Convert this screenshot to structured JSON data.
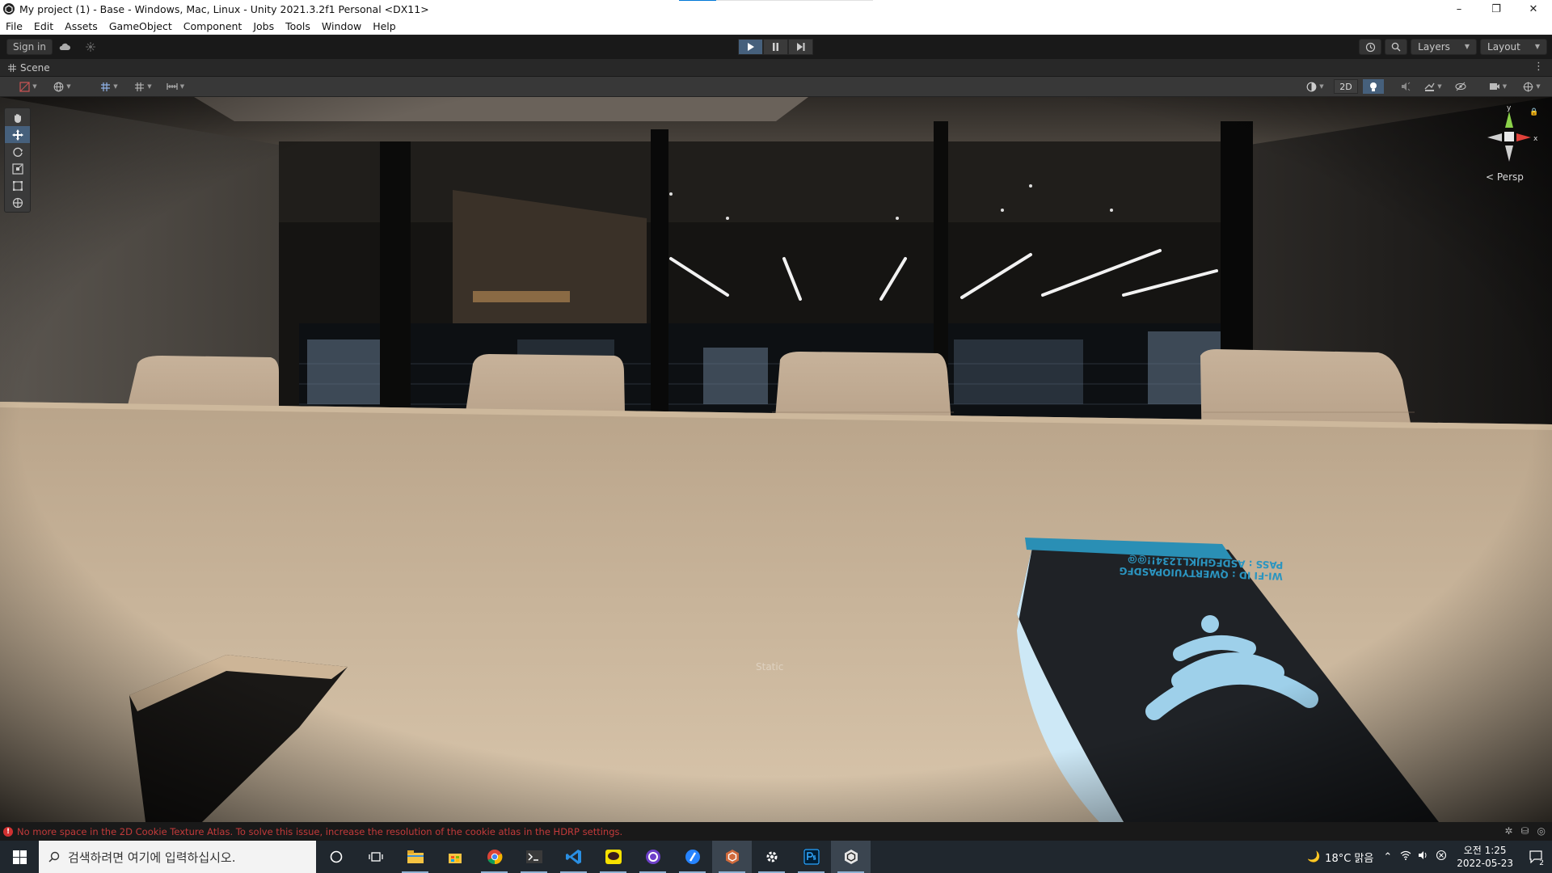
{
  "window": {
    "title": "My project (1) - Base - Windows, Mac, Linux - Unity 2021.3.2f1 Personal <DX11>",
    "minimize": "–",
    "maximize": "❐",
    "close": "✕"
  },
  "menu": [
    "File",
    "Edit",
    "Assets",
    "GameObject",
    "Component",
    "Jobs",
    "Tools",
    "Window",
    "Help"
  ],
  "toolbar": {
    "sign_in": "Sign in",
    "layers": "Layers",
    "layout": "Layout"
  },
  "scene": {
    "tab_label": "Scene",
    "btn_2d": "2D",
    "persp_label": "Persp",
    "overlay_text": "Static",
    "gizmo_x": "x",
    "gizmo_y": "y"
  },
  "sign": {
    "line1": "WI-FI ID : QWERTYUIOPASDFG",
    "line2": "PASS : ASDFGHJKL1234!!@@"
  },
  "status": {
    "message": "No more space in the 2D Cookie Texture Atlas. To solve this issue, increase the resolution of the cookie atlas in the HDRP settings."
  },
  "taskbar": {
    "search_placeholder": "검색하려면 여기에 입력하십시오.",
    "weather": "18°C 맑음",
    "time": "오전 1:25",
    "date": "2022-05-23",
    "notification_count": "2"
  },
  "colors": {
    "accent": "#46607c",
    "error": "#d23131",
    "taskbar": "#20272e"
  }
}
